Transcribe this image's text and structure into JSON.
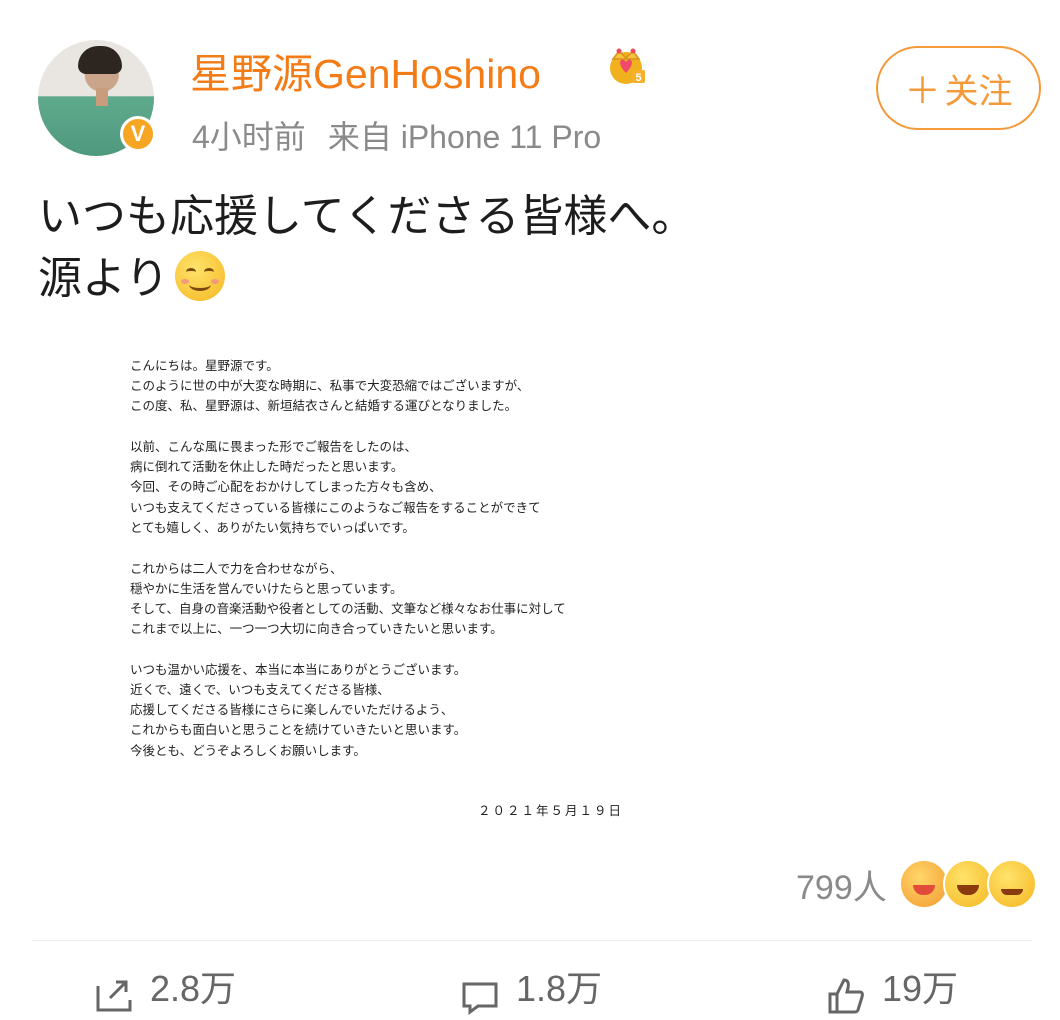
{
  "post": {
    "username": "星野源GenHoshino",
    "time": "4小时前",
    "source": "来自 iPhone 11 Pro",
    "follow_label": "关注",
    "text_line1": "いつも応援してくださる皆様へ。",
    "text_line2": "源より",
    "verified_badge": "V",
    "crown_level": "5"
  },
  "letter": {
    "paragraphs": [
      [
        "こんにちは。星野源です。",
        "このように世の中が大変な時期に、私事で大変恐縮ではございますが、",
        "この度、私、星野源は、新垣結衣さんと結婚する運びとなりました。"
      ],
      [
        "以前、こんな風に畏まった形でご報告をしたのは、",
        "病に倒れて活動を休止した時だったと思います。",
        "今回、その時ご心配をおかけしてしまった方々も含め、",
        "いつも支えてくださっている皆様にこのようなご報告をすることができて",
        "とても嬉しく、ありがたい気持ちでいっぱいです。"
      ],
      [
        "これからは二人で力を合わせながら、",
        "穏やかに生活を営んでいけたらと思っています。",
        "そして、自身の音楽活動や役者としての活動、文筆など様々なお仕事に対して",
        "これまで以上に、一つ一つ大切に向き合っていきたいと思います。"
      ],
      [
        "いつも温かい応援を、本当に本当にありがとうございます。",
        "近くで、遠くで、いつも支えてくださる皆様、",
        "応援してくださる皆様にさらに楽しんでいただけるよう、",
        "これからも面白いと思うことを続けていきたいと思います。",
        "今後とも、どうぞよろしくお願いします。"
      ]
    ],
    "date": "２０２１年５月１９日"
  },
  "reactions": {
    "count": "799人"
  },
  "actions": {
    "repost": "2.8万",
    "comment": "1.8万",
    "like": "19万"
  },
  "colors": {
    "accent": "#f47c17",
    "badge": "#f6a623",
    "meta": "#8a8a8a"
  }
}
